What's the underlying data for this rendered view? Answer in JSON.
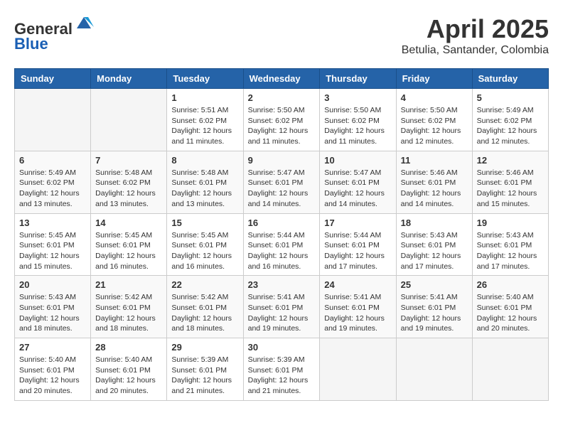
{
  "header": {
    "logo_line1": "General",
    "logo_line2": "Blue",
    "month": "April 2025",
    "location": "Betulia, Santander, Colombia"
  },
  "days_of_week": [
    "Sunday",
    "Monday",
    "Tuesday",
    "Wednesday",
    "Thursday",
    "Friday",
    "Saturday"
  ],
  "weeks": [
    [
      {
        "day": "",
        "info": ""
      },
      {
        "day": "",
        "info": ""
      },
      {
        "day": "1",
        "info": "Sunrise: 5:51 AM\nSunset: 6:02 PM\nDaylight: 12 hours and 11 minutes."
      },
      {
        "day": "2",
        "info": "Sunrise: 5:50 AM\nSunset: 6:02 PM\nDaylight: 12 hours and 11 minutes."
      },
      {
        "day": "3",
        "info": "Sunrise: 5:50 AM\nSunset: 6:02 PM\nDaylight: 12 hours and 11 minutes."
      },
      {
        "day": "4",
        "info": "Sunrise: 5:50 AM\nSunset: 6:02 PM\nDaylight: 12 hours and 12 minutes."
      },
      {
        "day": "5",
        "info": "Sunrise: 5:49 AM\nSunset: 6:02 PM\nDaylight: 12 hours and 12 minutes."
      }
    ],
    [
      {
        "day": "6",
        "info": "Sunrise: 5:49 AM\nSunset: 6:02 PM\nDaylight: 12 hours and 13 minutes."
      },
      {
        "day": "7",
        "info": "Sunrise: 5:48 AM\nSunset: 6:02 PM\nDaylight: 12 hours and 13 minutes."
      },
      {
        "day": "8",
        "info": "Sunrise: 5:48 AM\nSunset: 6:01 PM\nDaylight: 12 hours and 13 minutes."
      },
      {
        "day": "9",
        "info": "Sunrise: 5:47 AM\nSunset: 6:01 PM\nDaylight: 12 hours and 14 minutes."
      },
      {
        "day": "10",
        "info": "Sunrise: 5:47 AM\nSunset: 6:01 PM\nDaylight: 12 hours and 14 minutes."
      },
      {
        "day": "11",
        "info": "Sunrise: 5:46 AM\nSunset: 6:01 PM\nDaylight: 12 hours and 14 minutes."
      },
      {
        "day": "12",
        "info": "Sunrise: 5:46 AM\nSunset: 6:01 PM\nDaylight: 12 hours and 15 minutes."
      }
    ],
    [
      {
        "day": "13",
        "info": "Sunrise: 5:45 AM\nSunset: 6:01 PM\nDaylight: 12 hours and 15 minutes."
      },
      {
        "day": "14",
        "info": "Sunrise: 5:45 AM\nSunset: 6:01 PM\nDaylight: 12 hours and 16 minutes."
      },
      {
        "day": "15",
        "info": "Sunrise: 5:45 AM\nSunset: 6:01 PM\nDaylight: 12 hours and 16 minutes."
      },
      {
        "day": "16",
        "info": "Sunrise: 5:44 AM\nSunset: 6:01 PM\nDaylight: 12 hours and 16 minutes."
      },
      {
        "day": "17",
        "info": "Sunrise: 5:44 AM\nSunset: 6:01 PM\nDaylight: 12 hours and 17 minutes."
      },
      {
        "day": "18",
        "info": "Sunrise: 5:43 AM\nSunset: 6:01 PM\nDaylight: 12 hours and 17 minutes."
      },
      {
        "day": "19",
        "info": "Sunrise: 5:43 AM\nSunset: 6:01 PM\nDaylight: 12 hours and 17 minutes."
      }
    ],
    [
      {
        "day": "20",
        "info": "Sunrise: 5:43 AM\nSunset: 6:01 PM\nDaylight: 12 hours and 18 minutes."
      },
      {
        "day": "21",
        "info": "Sunrise: 5:42 AM\nSunset: 6:01 PM\nDaylight: 12 hours and 18 minutes."
      },
      {
        "day": "22",
        "info": "Sunrise: 5:42 AM\nSunset: 6:01 PM\nDaylight: 12 hours and 18 minutes."
      },
      {
        "day": "23",
        "info": "Sunrise: 5:41 AM\nSunset: 6:01 PM\nDaylight: 12 hours and 19 minutes."
      },
      {
        "day": "24",
        "info": "Sunrise: 5:41 AM\nSunset: 6:01 PM\nDaylight: 12 hours and 19 minutes."
      },
      {
        "day": "25",
        "info": "Sunrise: 5:41 AM\nSunset: 6:01 PM\nDaylight: 12 hours and 19 minutes."
      },
      {
        "day": "26",
        "info": "Sunrise: 5:40 AM\nSunset: 6:01 PM\nDaylight: 12 hours and 20 minutes."
      }
    ],
    [
      {
        "day": "27",
        "info": "Sunrise: 5:40 AM\nSunset: 6:01 PM\nDaylight: 12 hours and 20 minutes."
      },
      {
        "day": "28",
        "info": "Sunrise: 5:40 AM\nSunset: 6:01 PM\nDaylight: 12 hours and 20 minutes."
      },
      {
        "day": "29",
        "info": "Sunrise: 5:39 AM\nSunset: 6:01 PM\nDaylight: 12 hours and 21 minutes."
      },
      {
        "day": "30",
        "info": "Sunrise: 5:39 AM\nSunset: 6:01 PM\nDaylight: 12 hours and 21 minutes."
      },
      {
        "day": "",
        "info": ""
      },
      {
        "day": "",
        "info": ""
      },
      {
        "day": "",
        "info": ""
      }
    ]
  ]
}
